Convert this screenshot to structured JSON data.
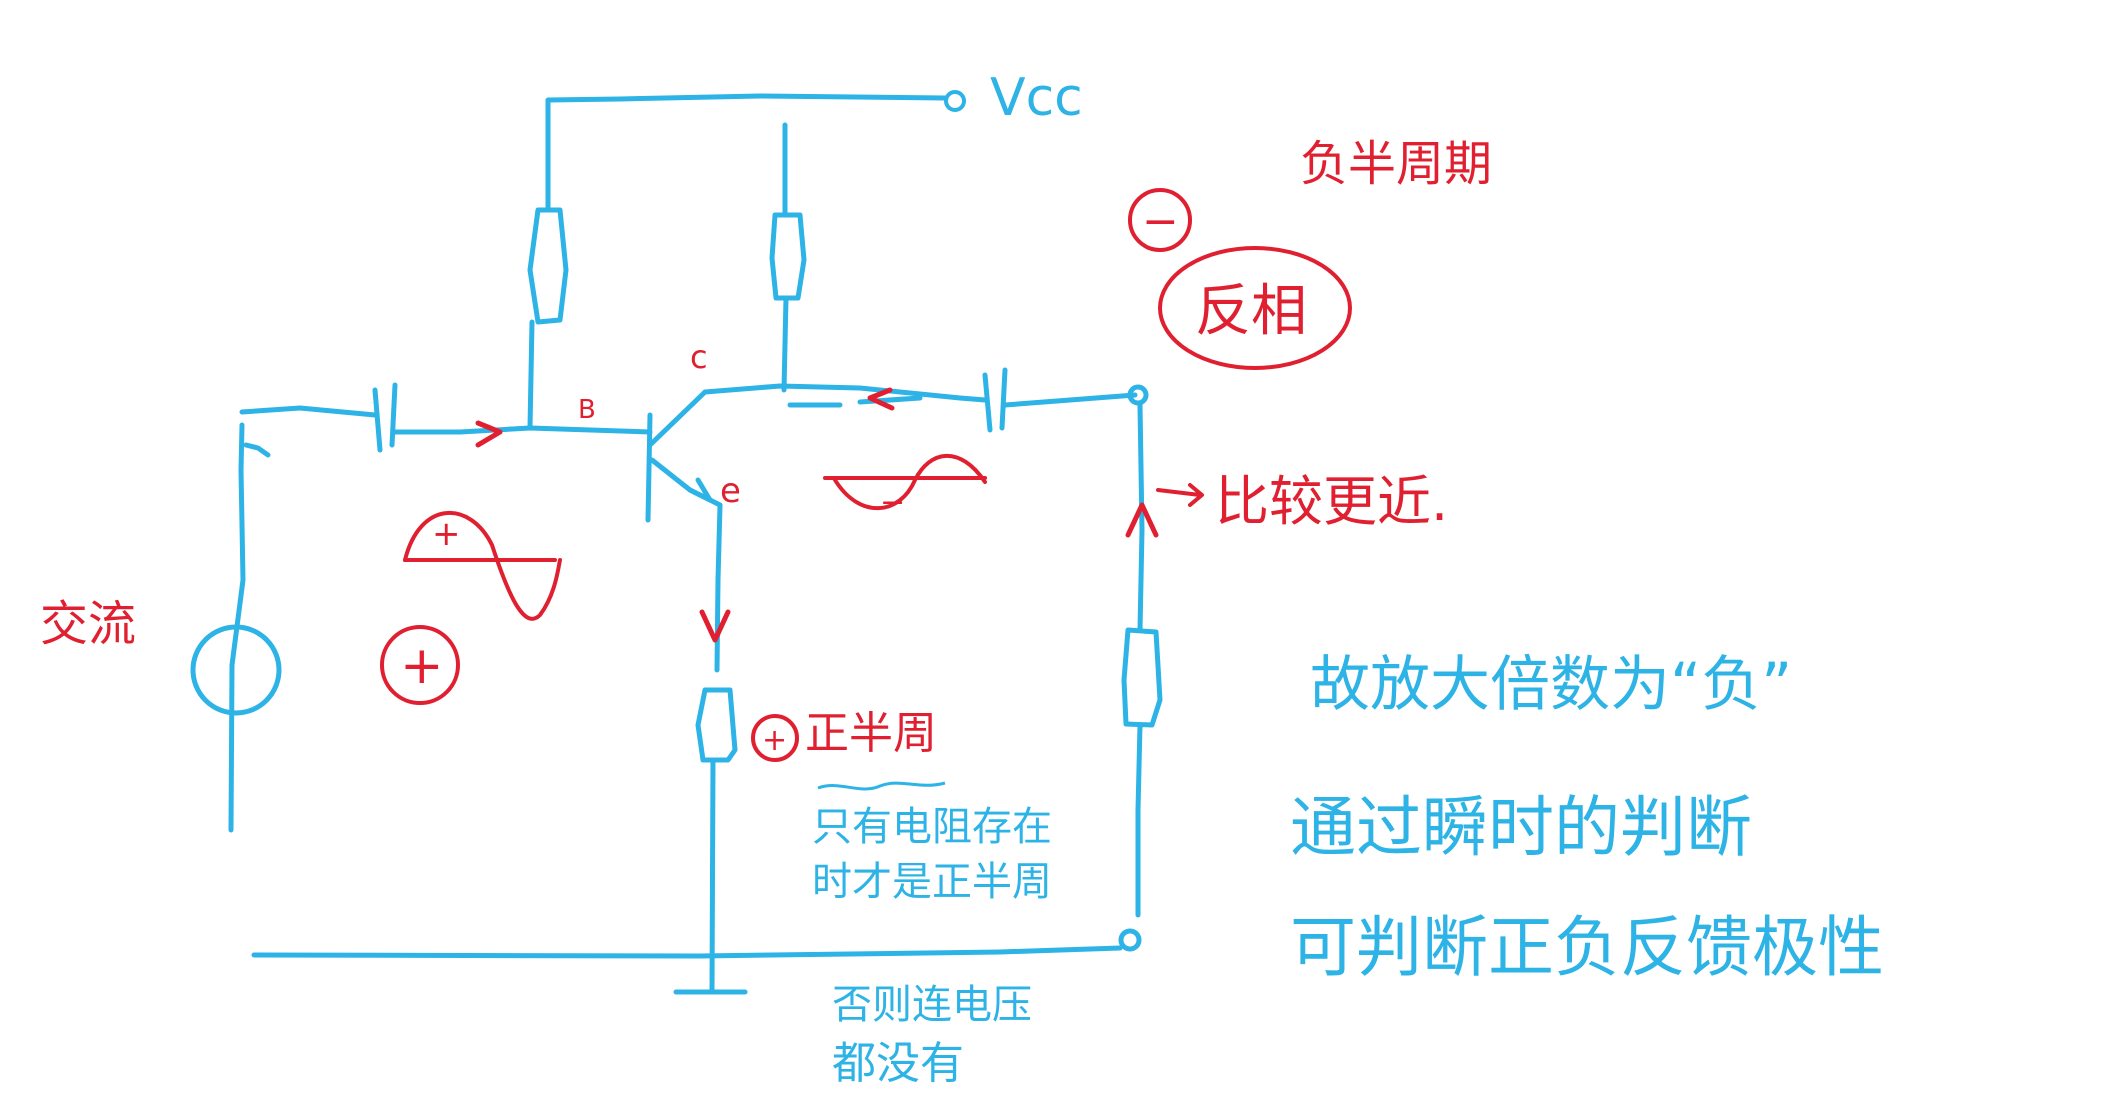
{
  "colors": {
    "circuit": "#2db3e6",
    "annotation": "#e02030",
    "note": "#2db3e6",
    "background": "#ffffff"
  },
  "circuit_labels": {
    "supply": "Vcc",
    "base": "B",
    "collector": "c",
    "emitter": "e",
    "source": "交流"
  },
  "polarity_marks": {
    "input_positive": "+",
    "input_wave_plus": "+",
    "output_wave_minus": "−",
    "output_negative": "−",
    "emitter_positive": "+"
  },
  "annotations": {
    "negative_half_cycle": "负半周期",
    "inverted_phase": "反相",
    "compare_more": "比较更近.",
    "positive_half_cycle": "正半周",
    "only_with_resistor": "只有电阻存在",
    "then_positive": "时才是正半周",
    "otherwise_line1": "否则连电压",
    "otherwise_line2": "都没有",
    "gain_negative": "故放大倍数为“负”",
    "instant_judgement": "通过瞬时的判断",
    "judge_feedback": "可判断正负反馈极性"
  },
  "icons": {
    "ac_source": "ac-source-circle-icon",
    "capacitor": "capacitor-icon",
    "resistor": "resistor-icon",
    "transistor": "npn-transistor-icon",
    "ground": "ground-icon"
  }
}
